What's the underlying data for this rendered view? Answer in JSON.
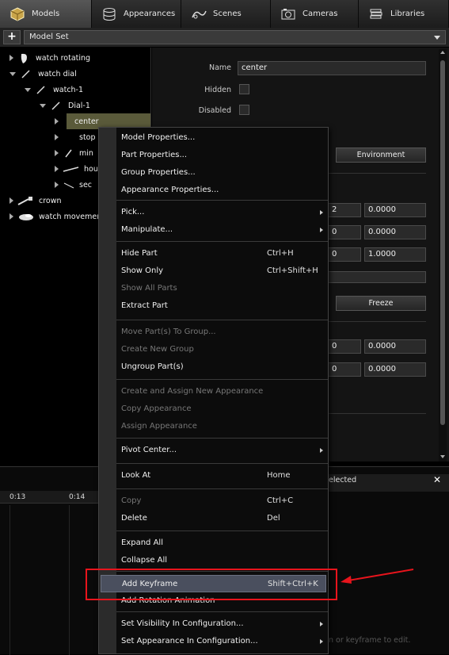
{
  "tabs": [
    {
      "label": "Models",
      "icon": "models-cube-icon",
      "active": true
    },
    {
      "label": "Appearances",
      "icon": "appearances-cylinder-icon",
      "active": false
    },
    {
      "label": "Scenes",
      "icon": "scenes-icon",
      "active": false
    },
    {
      "label": "Cameras",
      "icon": "camera-icon",
      "active": false
    },
    {
      "label": "Libraries",
      "icon": "libraries-icon",
      "active": false
    }
  ],
  "setbar": {
    "add_label": "+",
    "selected": "Model Set"
  },
  "tree": [
    {
      "label": "watch rotating"
    },
    {
      "label": "watch dial"
    },
    {
      "label": "watch-1"
    },
    {
      "label": "Dial-1"
    },
    {
      "label": "center"
    },
    {
      "label": "stop"
    },
    {
      "label": "min"
    },
    {
      "label": "hou"
    },
    {
      "label": "sec"
    },
    {
      "label": "crown"
    },
    {
      "label": "watch movemen"
    }
  ],
  "props": {
    "name_label": "Name",
    "name_value": "center",
    "hidden_label": "Hidden",
    "disabled_label": "Disabled",
    "environment_button": "Environment",
    "freeze_button": "Freeze",
    "row_values": [
      "0.0000",
      "0.0000",
      "1.0000",
      "0.0000",
      "0.0000"
    ],
    "partial_values": [
      "2",
      "0",
      "0",
      "0",
      "0"
    ]
  },
  "timeline": {
    "labels": [
      "0:13",
      "0:14"
    ],
    "selected_header": "elected",
    "hint": "n or keyframe to edit."
  },
  "menu": {
    "groups": [
      [
        {
          "label": "Model Properties...",
          "shortcut": "",
          "disabled": false,
          "submenu": false
        },
        {
          "label": "Part Properties...",
          "shortcut": "",
          "disabled": false,
          "submenu": false
        },
        {
          "label": "Group Properties...",
          "shortcut": "",
          "disabled": false,
          "submenu": false
        },
        {
          "label": "Appearance Properties...",
          "shortcut": "",
          "disabled": false,
          "submenu": false
        }
      ],
      [
        {
          "label": "Pick...",
          "shortcut": "",
          "disabled": false,
          "submenu": true
        },
        {
          "label": "Manipulate...",
          "shortcut": "",
          "disabled": false,
          "submenu": true
        }
      ],
      [
        {
          "label": "Hide Part",
          "shortcut": "Ctrl+H",
          "disabled": false,
          "submenu": false
        },
        {
          "label": "Show Only",
          "shortcut": "Ctrl+Shift+H",
          "disabled": false,
          "submenu": false
        },
        {
          "label": "Show All Parts",
          "shortcut": "",
          "disabled": true,
          "submenu": false
        },
        {
          "label": "Extract Part",
          "shortcut": "",
          "disabled": false,
          "submenu": false
        }
      ],
      [
        {
          "label": "Move Part(s) To Group...",
          "shortcut": "",
          "disabled": true,
          "submenu": false
        },
        {
          "label": "Create New Group",
          "shortcut": "",
          "disabled": true,
          "submenu": false
        },
        {
          "label": "Ungroup Part(s)",
          "shortcut": "",
          "disabled": false,
          "submenu": false
        }
      ],
      [
        {
          "label": "Create and Assign New Appearance",
          "shortcut": "",
          "disabled": true,
          "submenu": false
        },
        {
          "label": "Copy Appearance",
          "shortcut": "",
          "disabled": true,
          "submenu": false
        },
        {
          "label": "Assign Appearance",
          "shortcut": "",
          "disabled": true,
          "submenu": false
        }
      ],
      [
        {
          "label": "Pivot Center...",
          "shortcut": "",
          "disabled": false,
          "submenu": true
        }
      ],
      [
        {
          "label": "Look At",
          "shortcut": "Home",
          "disabled": false,
          "submenu": false
        }
      ],
      [
        {
          "label": "Copy",
          "shortcut": "Ctrl+C",
          "disabled": true,
          "submenu": false
        },
        {
          "label": "Delete",
          "shortcut": "Del",
          "disabled": false,
          "submenu": false
        }
      ],
      [
        {
          "label": "Expand All",
          "shortcut": "",
          "disabled": false,
          "submenu": false
        },
        {
          "label": "Collapse All",
          "shortcut": "",
          "disabled": false,
          "submenu": false
        }
      ],
      [
        {
          "label": "Add Keyframe",
          "shortcut": "Shift+Ctrl+K",
          "disabled": false,
          "submenu": false,
          "highlighted": true
        },
        {
          "label": "Add Rotation Animation",
          "shortcut": "",
          "disabled": false,
          "submenu": false
        }
      ],
      [
        {
          "label": "Set Visibility In Configuration...",
          "shortcut": "",
          "disabled": false,
          "submenu": true
        },
        {
          "label": "Set Appearance In Configuration...",
          "shortcut": "",
          "disabled": false,
          "submenu": true
        }
      ]
    ]
  },
  "colors": {
    "annotation": "#e8141c",
    "highlight": "#4a4f5e",
    "selected_tree": "#5a5a3a"
  }
}
